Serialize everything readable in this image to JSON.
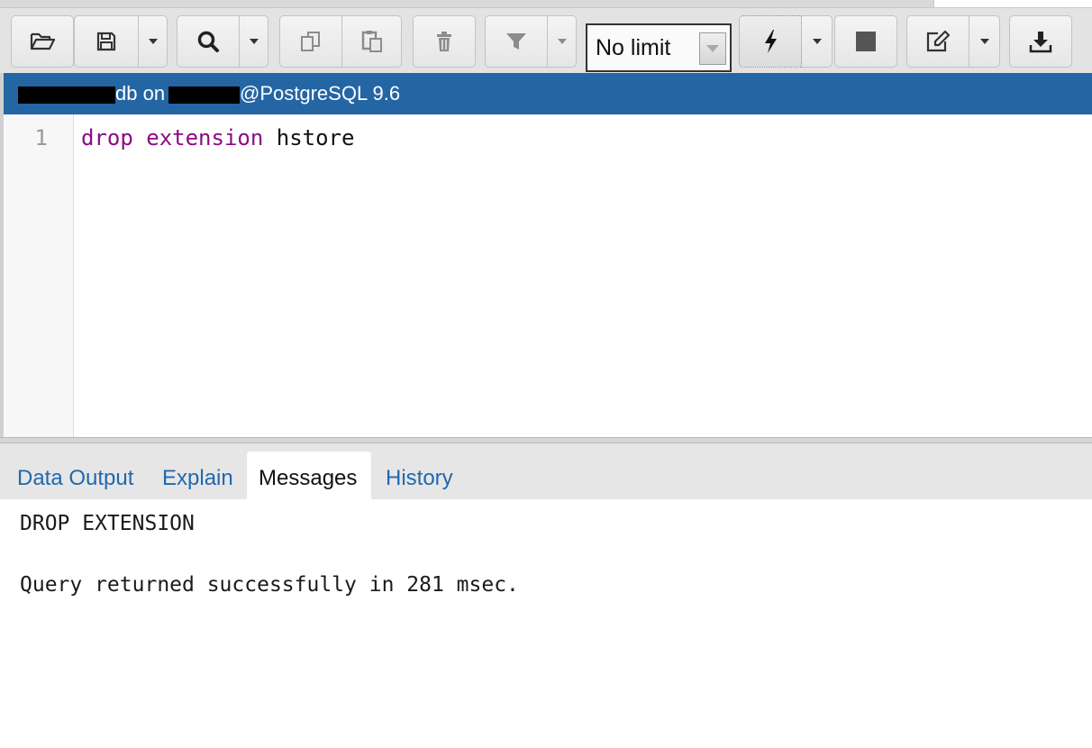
{
  "toolbar": {
    "limit_value": "No limit",
    "icons": {
      "open": "folder-open-icon",
      "save": "save-icon",
      "find": "search-icon",
      "copy": "copy-icon",
      "paste": "paste-icon",
      "delete": "trash-icon",
      "filter": "filter-icon",
      "execute": "lightning-icon",
      "stop": "stop-icon",
      "edit": "edit-icon",
      "download": "download-icon"
    }
  },
  "connection": {
    "db_suffix": "db on",
    "server": "@PostgreSQL 9.6"
  },
  "editor": {
    "line_number": "1",
    "keyword1": "drop",
    "keyword2": "extension",
    "identifier": "hstore"
  },
  "tabs": [
    "Data Output",
    "Explain",
    "Messages",
    "History"
  ],
  "active_tab": "Messages",
  "messages": {
    "line1": "DROP EXTENSION",
    "line2": "Query returned successfully in 281 msec."
  },
  "colors": {
    "connection_bar": "#2465a4",
    "keyword": "#8b0a85",
    "tab_link": "#2168ad"
  }
}
